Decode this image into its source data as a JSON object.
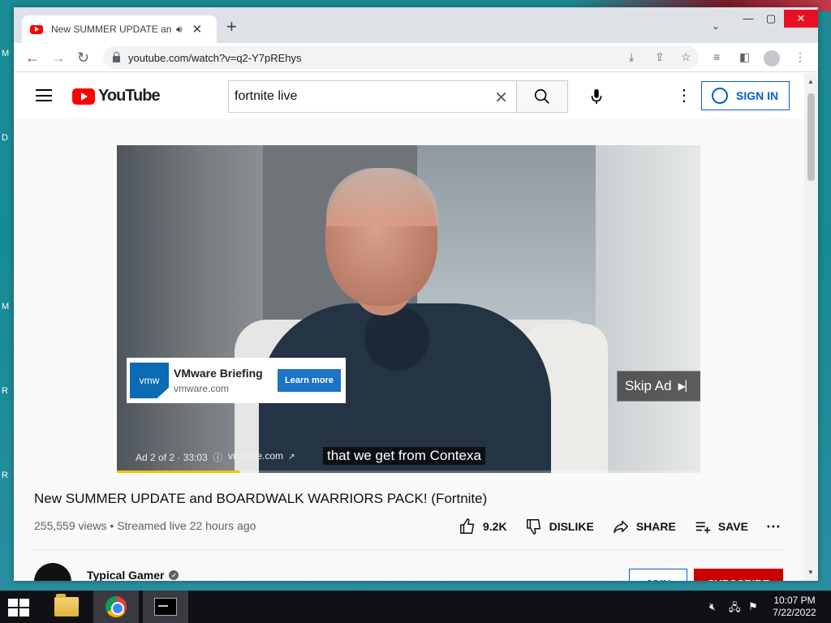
{
  "browser": {
    "tab_title": "New SUMMER UPDATE and BOARDWALK WARRIORS PACK! (Fortnite)",
    "url": "youtube.com/watch?v=q2-Y7pREhys"
  },
  "youtube": {
    "logo_text": "YouTube",
    "search_value": "fortnite live",
    "sign_in": "SIGN IN",
    "video_title": "New SUMMER UPDATE and BOARDWALK WARRIORS PACK! (Fortnite)",
    "views": "255,559 views",
    "streamed": "Streamed live 22 hours ago",
    "likes": "9.2K",
    "dislike": "DISLIKE",
    "share": "SHARE",
    "save": "SAVE",
    "channel": "Typical Gamer",
    "join": "JOIN",
    "subscribe": "SUBSCRIBE"
  },
  "ad": {
    "logo": "vmw",
    "title": "VMware Briefing",
    "domain": "vmware.com",
    "cta": "Learn more",
    "skip": "Skip Ad",
    "counter": "Ad 2 of 2 · 33:03",
    "domain_link": "vmware.com",
    "caption": "that we get from Contexa",
    "progress_fraction": 0.21
  },
  "taskbar": {
    "time": "10:07 PM",
    "date": "7/22/2022"
  },
  "colors": {
    "youtube_red": "#ff0000",
    "link_blue": "#065fd4",
    "subscribe_red": "#cc0000"
  }
}
